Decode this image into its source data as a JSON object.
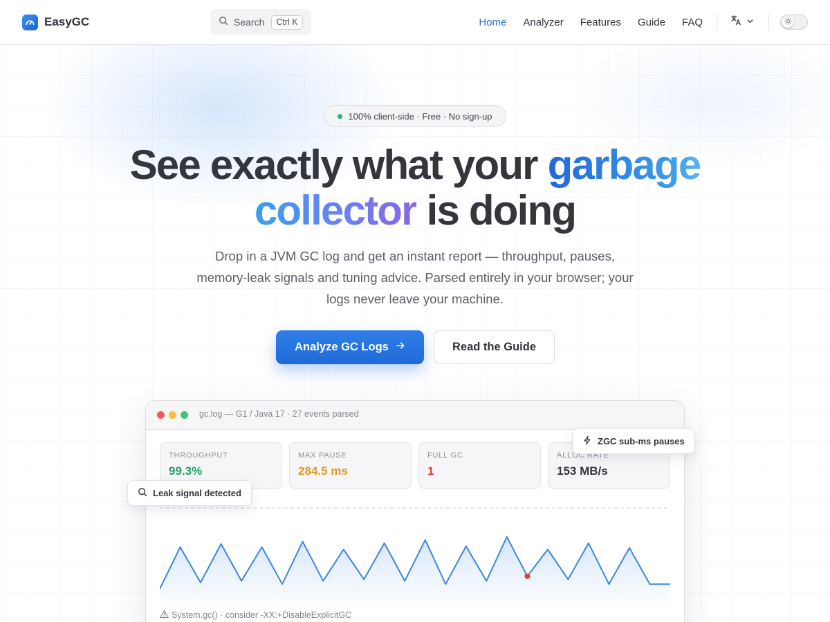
{
  "nav": {
    "brand": "EasyGC",
    "search_label": "Search",
    "search_shortcut": "Ctrl K",
    "links": [
      {
        "label": "Home",
        "active": true
      },
      {
        "label": "Analyzer",
        "active": false
      },
      {
        "label": "Features",
        "active": false
      },
      {
        "label": "Guide",
        "active": false
      },
      {
        "label": "FAQ",
        "active": false
      }
    ],
    "language_icon": "translate-icon",
    "theme": "light"
  },
  "hero": {
    "pill_text": "100% client-side · Free · No sign-up",
    "title_part1": "See exactly what your ",
    "title_highlight1": "garbage",
    "title_highlight2": "collector",
    "title_part2": " is doing",
    "subtitle": "Drop in a JVM GC log and get an instant report — throughput, pauses, memory-leak signals and tuning advice. Parsed entirely in your browser; your logs never leave your machine.",
    "primary_button": "Analyze GC Logs",
    "secondary_button": "Read the Guide"
  },
  "preview": {
    "window_title": "gc.log — G1 / Java 17 · 27 events parsed",
    "stats": [
      {
        "label": "THROUGHPUT",
        "value": "99.3%",
        "color": "#22a06b"
      },
      {
        "label": "MAX PAUSE",
        "value": "284.5 ms",
        "color": "#e8961c"
      },
      {
        "label": "FULL GC",
        "value": "1",
        "color": "#e0413f"
      },
      {
        "label": "ALLOC RATE",
        "value": "153 MB/s",
        "color": "#35353d"
      }
    ],
    "footer_note": "System.gc() · consider -XX:+DisableExplicitGC",
    "callout_leak": "Leak signal detected",
    "callout_zgc": "ZGC sub-ms pauses"
  },
  "colors": {
    "accent": "#2f73d4",
    "chart_line": "#3a86e0",
    "full_gc_marker": "#e0413f",
    "live_dot": "#22b573"
  },
  "chart_data": {
    "type": "line",
    "series": [
      {
        "values": [
          0.0,
          0.53,
          0.08,
          0.57,
          0.1,
          0.53,
          0.06,
          0.6,
          0.1,
          0.5,
          0.12,
          0.58,
          0.1,
          0.62,
          0.06,
          0.54,
          0.1,
          0.66,
          0.16,
          0.5,
          0.12,
          0.58,
          0.06,
          0.52,
          0.06,
          0.06
        ]
      }
    ],
    "full_gc_index": 18,
    "ylim": [
      0,
      1
    ],
    "grid": false
  }
}
